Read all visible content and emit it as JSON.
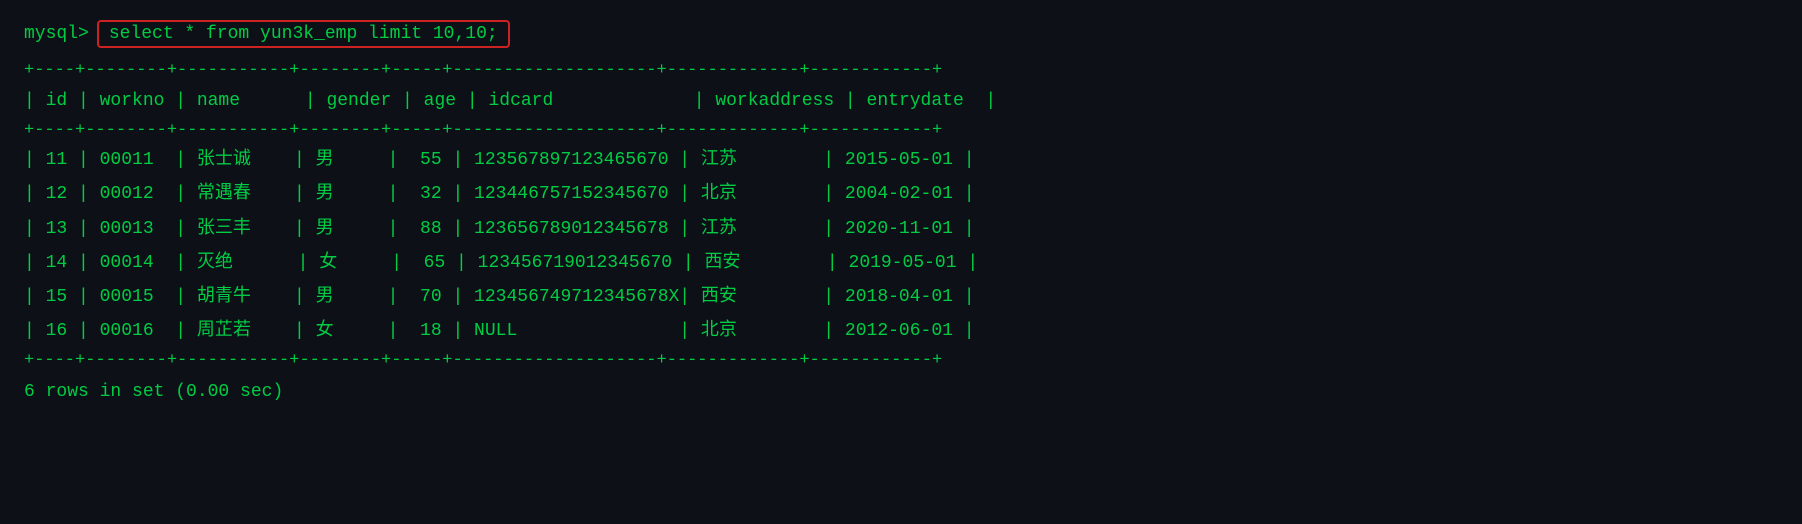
{
  "prompt": {
    "prefix": "mysql>",
    "query": "select * from yun3k_emp limit 10,10;"
  },
  "table": {
    "top_divider": "+----+--------+-----------+--------+-----+--------------------+-------------+------------+",
    "header_row": "| id | workno | name      | gender | age | idcard             | workaddress | entrydate  |",
    "mid_divider": "+----+--------+-----------+--------+-----+--------------------+-------------+------------+",
    "bottom_divider": "+----+--------+-----------+--------+-----+--------------------+-------------+------------+",
    "rows": [
      "| 11 | 00011  | 张士诚    | 男     |  55 | 123567897123465670 | 江苏        | 2015-05-01 |",
      "| 12 | 00012  | 常遇春    | 男     |  32 | 123446757152345670 | 北京        | 2004-02-01 |",
      "| 13 | 00013  | 张三丰    | 男     |  88 | 123656789012345678 | 江苏        | 2020-11-01 |",
      "| 14 | 00014  | 灭绝      | 女     |  65 | 123456719012345670 | 西安        | 2019-05-01 |",
      "| 15 | 00015  | 胡青牛    | 男     |  70 | 123456749712345678X| 西安        | 2018-04-01 |",
      "| 16 | 00016  | 周芷若    | 女     |  18 | NULL               | 北京        | 2012-06-01 |"
    ]
  },
  "footer": {
    "text": "6 rows in set (0.00 sec)"
  }
}
